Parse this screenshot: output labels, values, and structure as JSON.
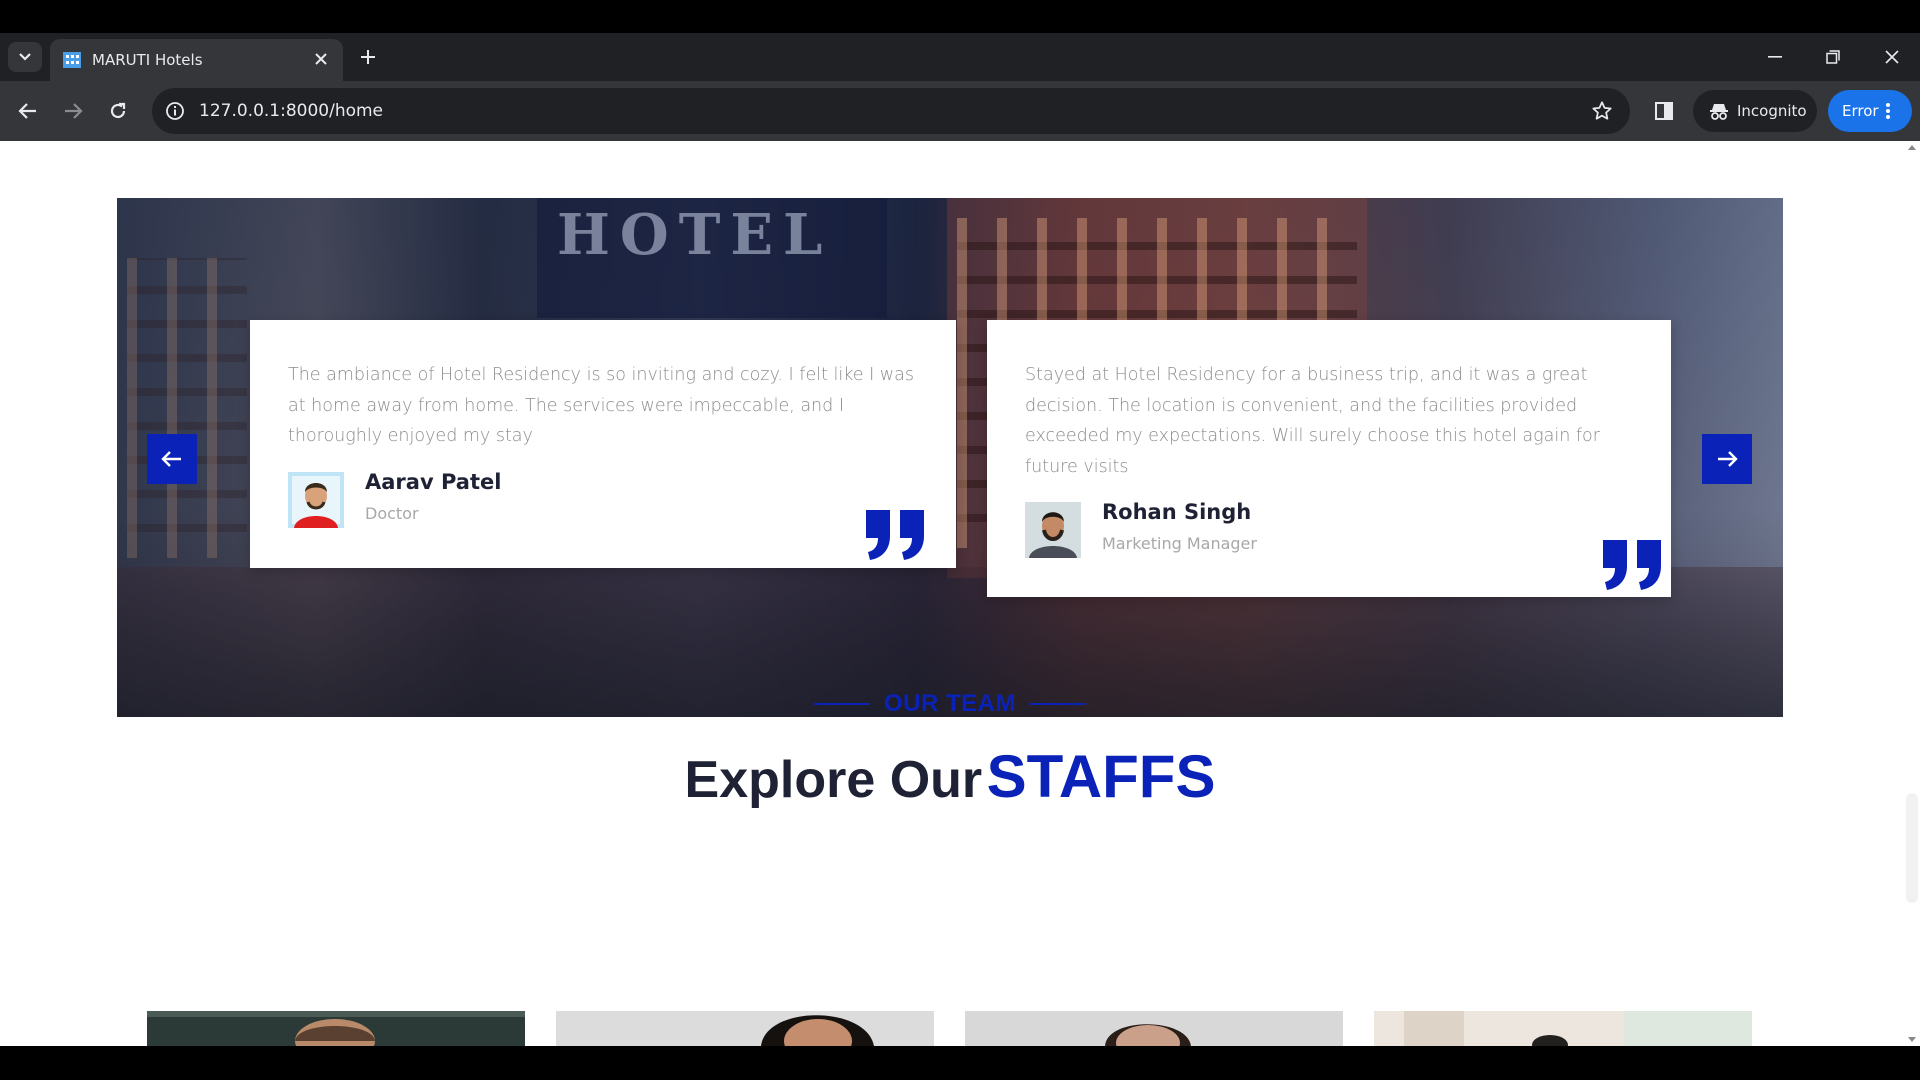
{
  "browser": {
    "tab_title": "MARUTI Hotels",
    "url": "127.0.0.1:8000/home",
    "incognito_label": "Incognito",
    "error_label": "Error",
    "icons": [
      "tab-list-icon",
      "hotel-favicon-icon",
      "close-icon",
      "plus-icon",
      "minimize-icon",
      "restore-icon",
      "window-close-icon",
      "back-icon",
      "forward-icon",
      "reload-icon",
      "info-icon",
      "star-icon",
      "side-panel-icon",
      "incognito-icon",
      "kebab-menu-icon"
    ]
  },
  "testimonials": {
    "background_sign": "HOTEL",
    "prev_icon": "arrow-left-icon",
    "next_icon": "arrow-right-icon",
    "accent_color": "#0b22b8",
    "items": [
      {
        "text": "The ambiance of Hotel Residency is so inviting and cozy. I felt like I was at home away from home. The services were impeccable, and I thoroughly enjoyed my stay",
        "name": "Aarav Patel",
        "role": "Doctor"
      },
      {
        "text": "Stayed at Hotel Residency for a business trip, and it was a great decision. The location is convenient, and the facilities provided exceeded my expectations. Will surely choose this hotel again for future visits",
        "name": "Rohan Singh",
        "role": "Marketing Manager"
      }
    ]
  },
  "team": {
    "label": "OUR TEAM",
    "heading_main": "Explore Our",
    "heading_accent": "STAFFS"
  }
}
